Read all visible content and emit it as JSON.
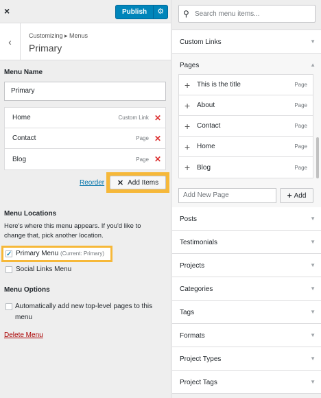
{
  "topbar": {
    "close_icon": "×",
    "publish_label": "Publish",
    "settings_icon": "⚙"
  },
  "section": {
    "back_icon": "‹",
    "breadcrumb": "Customizing ▸ Menus",
    "title": "Primary"
  },
  "menu_name": {
    "label": "Menu Name",
    "value": "Primary"
  },
  "menu_items": [
    {
      "name": "Home",
      "type": "Custom Link"
    },
    {
      "name": "Contact",
      "type": "Page"
    },
    {
      "name": "Blog",
      "type": "Page"
    }
  ],
  "actions": {
    "reorder": "Reorder",
    "add_items": "Add Items",
    "add_icon": "✕"
  },
  "locations": {
    "heading": "Menu Locations",
    "description": "Here's where this menu appears. If you'd like to change that, pick another location.",
    "primary_label": "Primary Menu",
    "primary_current": "(Current: Primary)",
    "social_label": "Social Links Menu"
  },
  "options": {
    "heading": "Menu Options",
    "auto_add": "Automatically add new top-level pages to this menu"
  },
  "delete_menu": "Delete Menu",
  "search": {
    "placeholder": "Search menu items..."
  },
  "panels": {
    "custom_links": "Custom Links",
    "pages": "Pages",
    "posts": "Posts",
    "testimonials": "Testimonials",
    "projects": "Projects",
    "categories": "Categories",
    "tags": "Tags",
    "formats": "Formats",
    "project_types": "Project Types",
    "project_tags": "Project Tags"
  },
  "pages": [
    {
      "name": "This is the title",
      "type": "Page"
    },
    {
      "name": "About",
      "type": "Page"
    },
    {
      "name": "Contact",
      "type": "Page"
    },
    {
      "name": "Home",
      "type": "Page"
    },
    {
      "name": "Blog",
      "type": "Page"
    }
  ],
  "new_page": {
    "placeholder": "Add New Page",
    "add_label": "Add"
  },
  "colors": {
    "accent": "#0085ba",
    "highlight": "#f6b839",
    "danger": "#dc3232",
    "link": "#0073aa"
  }
}
